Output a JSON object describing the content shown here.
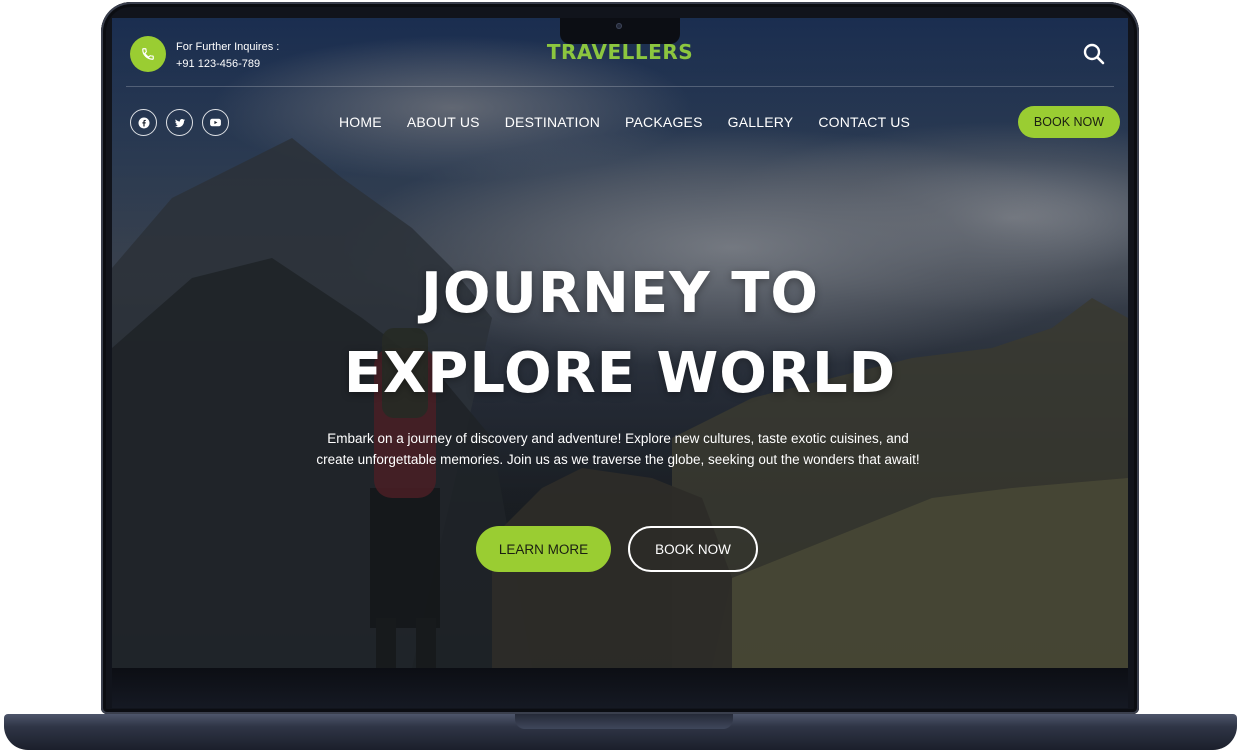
{
  "contact": {
    "label": "For Further Inquires :",
    "phone": "+91 123-456-789"
  },
  "brand": {
    "name": "TRAVELLERS",
    "color": "#8CC63F"
  },
  "accent_color": "#9ACD32",
  "icons": [
    "phone-icon",
    "search-icon",
    "facebook-icon",
    "twitter-icon",
    "youtube-icon"
  ],
  "nav": {
    "items": [
      "HOME",
      "ABOUT US",
      "DESTINATION",
      "PACKAGES",
      "GALLERY",
      "CONTACT US"
    ],
    "book_label": "BOOK NOW"
  },
  "hero": {
    "title_line1": "JOURNEY TO",
    "title_line2": "EXPLORE WORLD",
    "description": "Embark on a journey of discovery and adventure! Explore new cultures, taste exotic cuisines, and create unforgettable memories. Join us as we traverse the globe, seeking out the wonders that await!",
    "primary_button": "LEARN MORE",
    "secondary_button": "BOOK NOW"
  }
}
